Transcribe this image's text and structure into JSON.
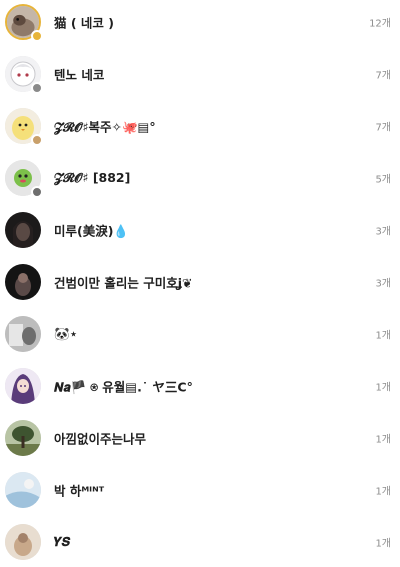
{
  "colors": {
    "ring": "#e7b43a",
    "count_text": "#8e8e8e",
    "name_text": "#202020"
  },
  "rows": [
    {
      "name": "猫 ( 네코 )",
      "count": "12개",
      "avatar": "cat-photo",
      "ring": true,
      "badge": "#e7b43a"
    },
    {
      "name": "텐노 네코",
      "count": "7개",
      "avatar": "white-hair-character",
      "ring": false,
      "badge": "#8a8a8a"
    },
    {
      "name": "𝓩𝓡𝓞♯복주✧🐙▤°",
      "count": "7개",
      "avatar": "yellow-bird",
      "ring": false,
      "badge": "#c9a06a"
    },
    {
      "name": "𝓩𝓡𝓞♯ [882]",
      "count": "5개",
      "avatar": "green-figure",
      "ring": false,
      "badge": "#6e6e6e"
    },
    {
      "name": "미루(美淚)💧",
      "count": "3개",
      "avatar": "dark-portrait",
      "ring": false,
      "badge": null
    },
    {
      "name": "건범이만 홀리는 구미호ʝ❦",
      "count": "3개",
      "avatar": "dark-photo",
      "ring": false,
      "badge": null
    },
    {
      "name": "🐼⋆",
      "count": "1개",
      "avatar": "gray-photo",
      "ring": false,
      "badge": null
    },
    {
      "name": "𝑵𝒂🏴 ⍟ 유월▤.˙ ヤ三C°",
      "count": "1개",
      "avatar": "purple-character",
      "ring": false,
      "badge": null
    },
    {
      "name": "아낌없이주는나무",
      "count": "1개",
      "avatar": "tree",
      "ring": false,
      "badge": null
    },
    {
      "name": "박 하ᴹᴵᴺᵀ",
      "count": "1개",
      "avatar": "light-blue-photo",
      "ring": false,
      "badge": null
    },
    {
      "name": "𝒀𝑺",
      "count": "1개",
      "avatar": "beige-photo",
      "ring": false,
      "badge": null
    }
  ]
}
